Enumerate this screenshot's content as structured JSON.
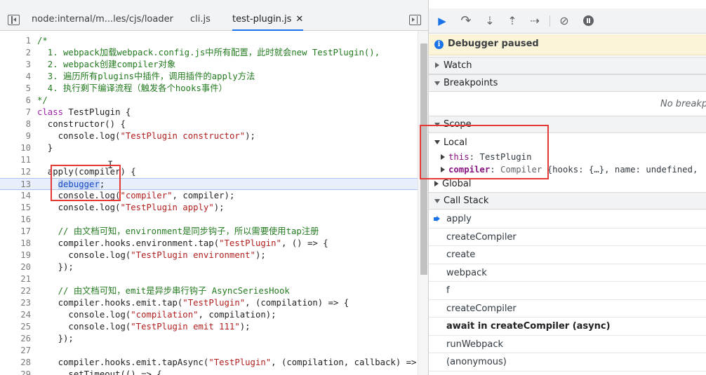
{
  "editor": {
    "tabs": [
      {
        "label": "node:internal/m...les/cjs/loader"
      },
      {
        "label": "cli.js"
      },
      {
        "label": "test-plugin.js",
        "close": "✕",
        "active": true
      }
    ],
    "lines": [
      {
        "n": "1",
        "text": "/*",
        "cls": "cm"
      },
      {
        "n": "2",
        "text": "  1. webpack加载webpack.config.js中所有配置，此时就会new TestPlugin(),",
        "cls": "cm"
      },
      {
        "n": "3",
        "text": "  2. webpack创建compiler对象",
        "cls": "cm"
      },
      {
        "n": "4",
        "text": "  3. 遍历所有plugins中插件，调用插件的apply方法",
        "cls": "cm"
      },
      {
        "n": "5",
        "text": "  4. 执行剩下编译流程（触发各个hooks事件）",
        "cls": "cm"
      },
      {
        "n": "6",
        "text": "*/",
        "cls": "cm"
      },
      {
        "n": "7",
        "html": "<span class=\"kw\">class</span> TestPlugin {"
      },
      {
        "n": "8",
        "text": "  constructor() {"
      },
      {
        "n": "9",
        "html": "    console.log(<span class=\"str\">\"TestPlugin constructor\"</span>);"
      },
      {
        "n": "10",
        "text": "  }"
      },
      {
        "n": "11",
        "text": ""
      },
      {
        "n": "12",
        "text": "  apply(compiler) {"
      },
      {
        "n": "13",
        "html": "    <span class=\"dbg\">debugger</span>;",
        "current": true
      },
      {
        "n": "14",
        "html": "    console.log(<span class=\"str\">\"compiler\"</span>, compiler);"
      },
      {
        "n": "15",
        "html": "    console.log(<span class=\"str\">\"TestPlugin apply\"</span>);"
      },
      {
        "n": "16",
        "text": ""
      },
      {
        "n": "17",
        "text": "    // 由文档可知，environment是同步钩子，所以需要使用tap注册",
        "cls": "cm"
      },
      {
        "n": "18",
        "html": "    compiler.hooks.environment.tap(<span class=\"str\">\"TestPlugin\"</span>, () =&gt; {"
      },
      {
        "n": "19",
        "html": "      console.log(<span class=\"str\">\"TestPlugin environment\"</span>);"
      },
      {
        "n": "20",
        "text": "    });"
      },
      {
        "n": "21",
        "text": ""
      },
      {
        "n": "22",
        "text": "    // 由文档可知，emit是异步串行钩子 AsyncSeriesHook",
        "cls": "cm"
      },
      {
        "n": "23",
        "html": "    compiler.hooks.emit.tap(<span class=\"str\">\"TestPlugin\"</span>, (compilation) =&gt; {"
      },
      {
        "n": "24",
        "html": "      console.log(<span class=\"str\">\"compilation\"</span>, compilation);"
      },
      {
        "n": "25",
        "html": "      console.log(<span class=\"str\">\"TestPlugin emit 111\"</span>);"
      },
      {
        "n": "26",
        "text": "    });"
      },
      {
        "n": "27",
        "text": ""
      },
      {
        "n": "28",
        "html": "    compiler.hooks.emit.tapAsync(<span class=\"str\">\"TestPlugin\"</span>, (compilation, callback) =&gt; {"
      },
      {
        "n": "29",
        "text": "      setTimeout(() => {"
      }
    ]
  },
  "debugger": {
    "paused_text": "Debugger paused",
    "info_icon": "i",
    "sections": {
      "watch": "Watch",
      "breakpoints": "Breakpoints",
      "scope": "Scope",
      "call_stack": "Call Stack"
    },
    "no_breakpoints": "No breakpoints",
    "scope": {
      "local": "Local",
      "this_name": "this",
      "this_value": "TestPlugin",
      "compiler_name": "compiler",
      "compiler_value": "Compiler",
      "compiler_preview": "{hooks: {…}, name: undefined,",
      "global": "Global"
    },
    "call_stack": [
      {
        "label": "apply",
        "current": true
      },
      {
        "label": "createCompiler"
      },
      {
        "label": "create"
      },
      {
        "label": "webpack"
      },
      {
        "label": "f"
      },
      {
        "label": "createCompiler"
      },
      {
        "label": "await in createCompiler (async)",
        "async": true
      },
      {
        "label": "runWebpack"
      },
      {
        "label": "(anonymous)"
      }
    ]
  },
  "colors": {
    "accent": "#1a73e8",
    "annotation_red": "#e53935",
    "paused_banner": "#fcf4d8"
  },
  "icons": [
    "resume-icon",
    "step-over-icon",
    "step-into-icon",
    "step-out-icon",
    "step-icon",
    "deactivate-breakpoints-icon",
    "pause-on-exceptions-icon",
    "info-icon",
    "current-frame-arrow-icon"
  ]
}
